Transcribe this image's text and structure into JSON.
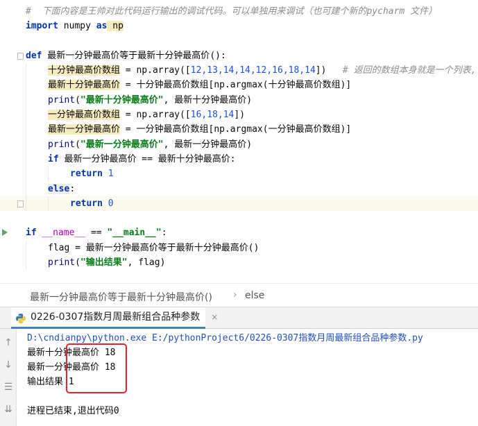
{
  "editor": {
    "top_comment": "#  下面内容是王帅对此代码运行输出的调试代码。可以单独用来调试（也可建个新的pycharm 文件）",
    "import_line": {
      "kw1": "import",
      "mod": " numpy ",
      "kw2": "as",
      "alias": " np"
    },
    "def_line": {
      "kw": "def",
      "name": " 最新一分钟最高价等于最新十分钟最高价",
      "rest": "():"
    },
    "line_arr1": {
      "var": "十分钟最高价数组",
      "mid": " = np.array([",
      "nums": "12,13,14,14,12,16,18,14",
      "end": "])",
      "comment": "# 返回的数组本身就是一个列表,"
    },
    "line_max10": {
      "var": "最新十分钟最高价",
      "rest": " = 十分钟最高价数组[np.argmax(十分钟最高价数组)]"
    },
    "line_print1": {
      "fn": "print",
      "open": "(",
      "str": "\"最新十分钟最高价\"",
      "rest": ", 最新十分钟最高价)"
    },
    "line_arr2": {
      "var": "一分钟最高价数组",
      "mid": " = np.array([",
      "nums": "16,18,14",
      "end": "])"
    },
    "line_max1": {
      "var": "最新一分钟最高价",
      "rest": " = 一分钟最高价数组[np.argmax(一分钟最高价数组)]"
    },
    "line_print2": {
      "fn": "print",
      "open": "(",
      "str": "\"最新一分钟最高价\"",
      "rest": ", 最新一分钟最高价)"
    },
    "line_if": {
      "kw": "if",
      "rest": " 最新一分钟最高价 == 最新十分钟最高价:"
    },
    "line_ret1": {
      "kw": "return",
      "num": " 1"
    },
    "line_else": {
      "kw": "else",
      "rest": ":"
    },
    "line_ret0": {
      "kw": "return",
      "num": " 0"
    },
    "line_main": {
      "kw": "if",
      "dunder": " __name__",
      "mid": " == ",
      "str": "\"__main__\"",
      "end": ":"
    },
    "line_flag": {
      "text": "flag = 最新一分钟最高价等于最新十分钟最高价()"
    },
    "line_print3": {
      "fn": "print",
      "open": "(",
      "str": "\"输出结果\"",
      "rest": ", flag)"
    }
  },
  "breadcrumb": {
    "item1": "最新一分钟最高价等于最新十分钟最高价()",
    "sep": "›",
    "item2": "else"
  },
  "run_panel": {
    "tab_label": "0226-0307指数月周最新组合品种参数",
    "close": "×",
    "console": {
      "cmd": "D:\\cndianpy\\python.exe E:/pythonProject6/0226-0307指数月周最新组合品种参数.py",
      "out1": "最新十分钟最高价 18",
      "out2": "最新一分钟最高价 18",
      "out3": "输出结果 1",
      "exit": "进程已结束,退出代码0"
    }
  },
  "colors": {
    "keyword": "#0033b3",
    "string": "#067d17",
    "number": "#1750eb",
    "comment": "#8c8c8c",
    "highlight_box": "#e3242b"
  },
  "icons": [
    "fold-marker-icon",
    "run-arrow-icon",
    "python-icon",
    "close-icon",
    "scroll-up-icon",
    "scroll-down-icon",
    "soft-wrap-icon",
    "scroll-to-end-icon"
  ]
}
